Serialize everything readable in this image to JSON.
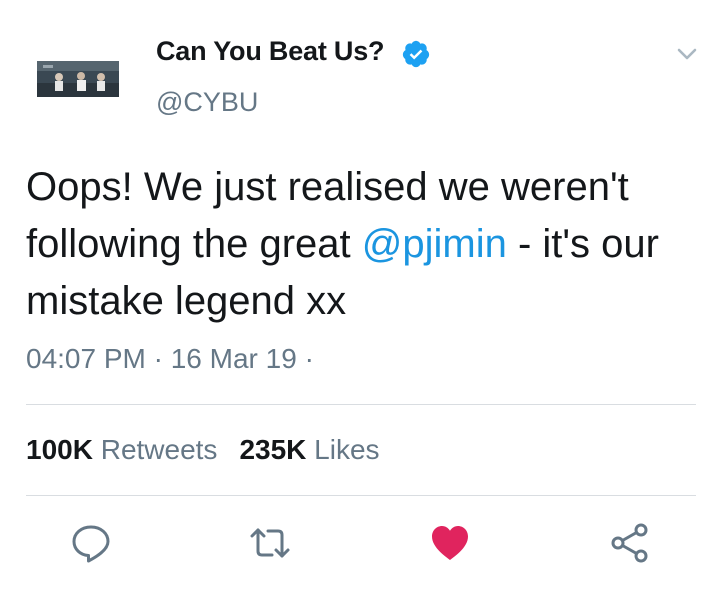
{
  "header": {
    "display_name": "Can You Beat Us?",
    "handle": "@CYBU"
  },
  "tweet": {
    "text_before": "Oops! We just realised we weren't following the great ",
    "mention": "@pjimin",
    "text_after": " - it's our mistake legend xx",
    "timestamp": "04:07 PM · 16 Mar 19 · "
  },
  "stats": {
    "retweets_count": "100K",
    "retweets_label": "Retweets",
    "likes_count": "235K",
    "likes_label": "Likes"
  },
  "icons": {
    "verified": "verified-badge-icon",
    "caret": "chevron-down-icon",
    "reply": "reply-icon",
    "retweet": "retweet-icon",
    "like": "heart-icon",
    "share": "share-icon"
  },
  "colors": {
    "accent": "#1b95e0",
    "like": "#e0245e",
    "secondary_text": "#657786",
    "primary_text": "#14171a",
    "divider": "#d9dde1"
  }
}
